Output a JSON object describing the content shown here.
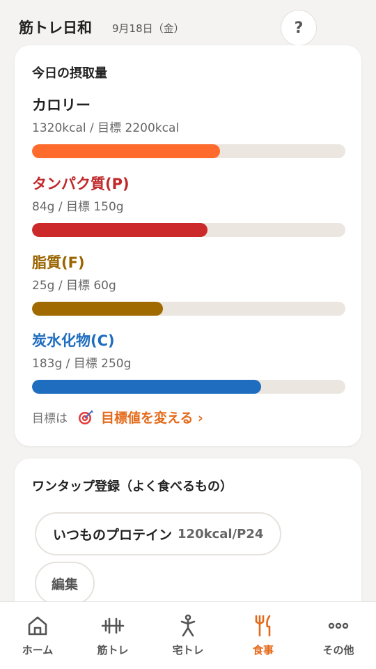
{
  "header": {
    "title": "筋トレ日和",
    "date": "9月18日（金）",
    "help_label": "?"
  },
  "intake": {
    "title": "今日の摂取量",
    "nutrients": [
      {
        "label": "カロリー",
        "value_text": "1320kcal / 目標 2200kcal",
        "progress": 0.6,
        "color": "#ff6b2c",
        "label_color": "#222222"
      },
      {
        "label": "タンパク質(P)",
        "value_text": "84g / 目標 150g",
        "progress": 0.56,
        "color": "#cc2a2a",
        "label_color": "#c0282a"
      },
      {
        "label": "脂質(F)",
        "value_text": "25g / 目標 60g",
        "progress": 0.417,
        "color": "#a06a00",
        "label_color": "#9a6400"
      },
      {
        "label": "炭水化物(C)",
        "value_text": "183g / 目標 250g",
        "progress": 0.732,
        "color": "#1f6dbf",
        "label_color": "#1f6dbf"
      }
    ],
    "goal_prefix": "目標は",
    "goal_icon": "target-icon",
    "goal_link": "目標値を変える ›"
  },
  "onetap": {
    "title": "ワンタップ登録（よく食べるもの）",
    "chips": [
      {
        "name": "いつものプロテイン",
        "meta": "120kcal/P24"
      }
    ],
    "edit_label": "編集"
  },
  "tabbar": {
    "active_color": "#e46a1a",
    "items": [
      {
        "label": "ホーム",
        "icon": "home-icon"
      },
      {
        "label": "筋トレ",
        "icon": "dumbbell-icon"
      },
      {
        "label": "宅トレ",
        "icon": "person-icon"
      },
      {
        "label": "食事",
        "icon": "fork-knife-icon",
        "active": true
      },
      {
        "label": "その他",
        "icon": "more-icon"
      }
    ]
  }
}
